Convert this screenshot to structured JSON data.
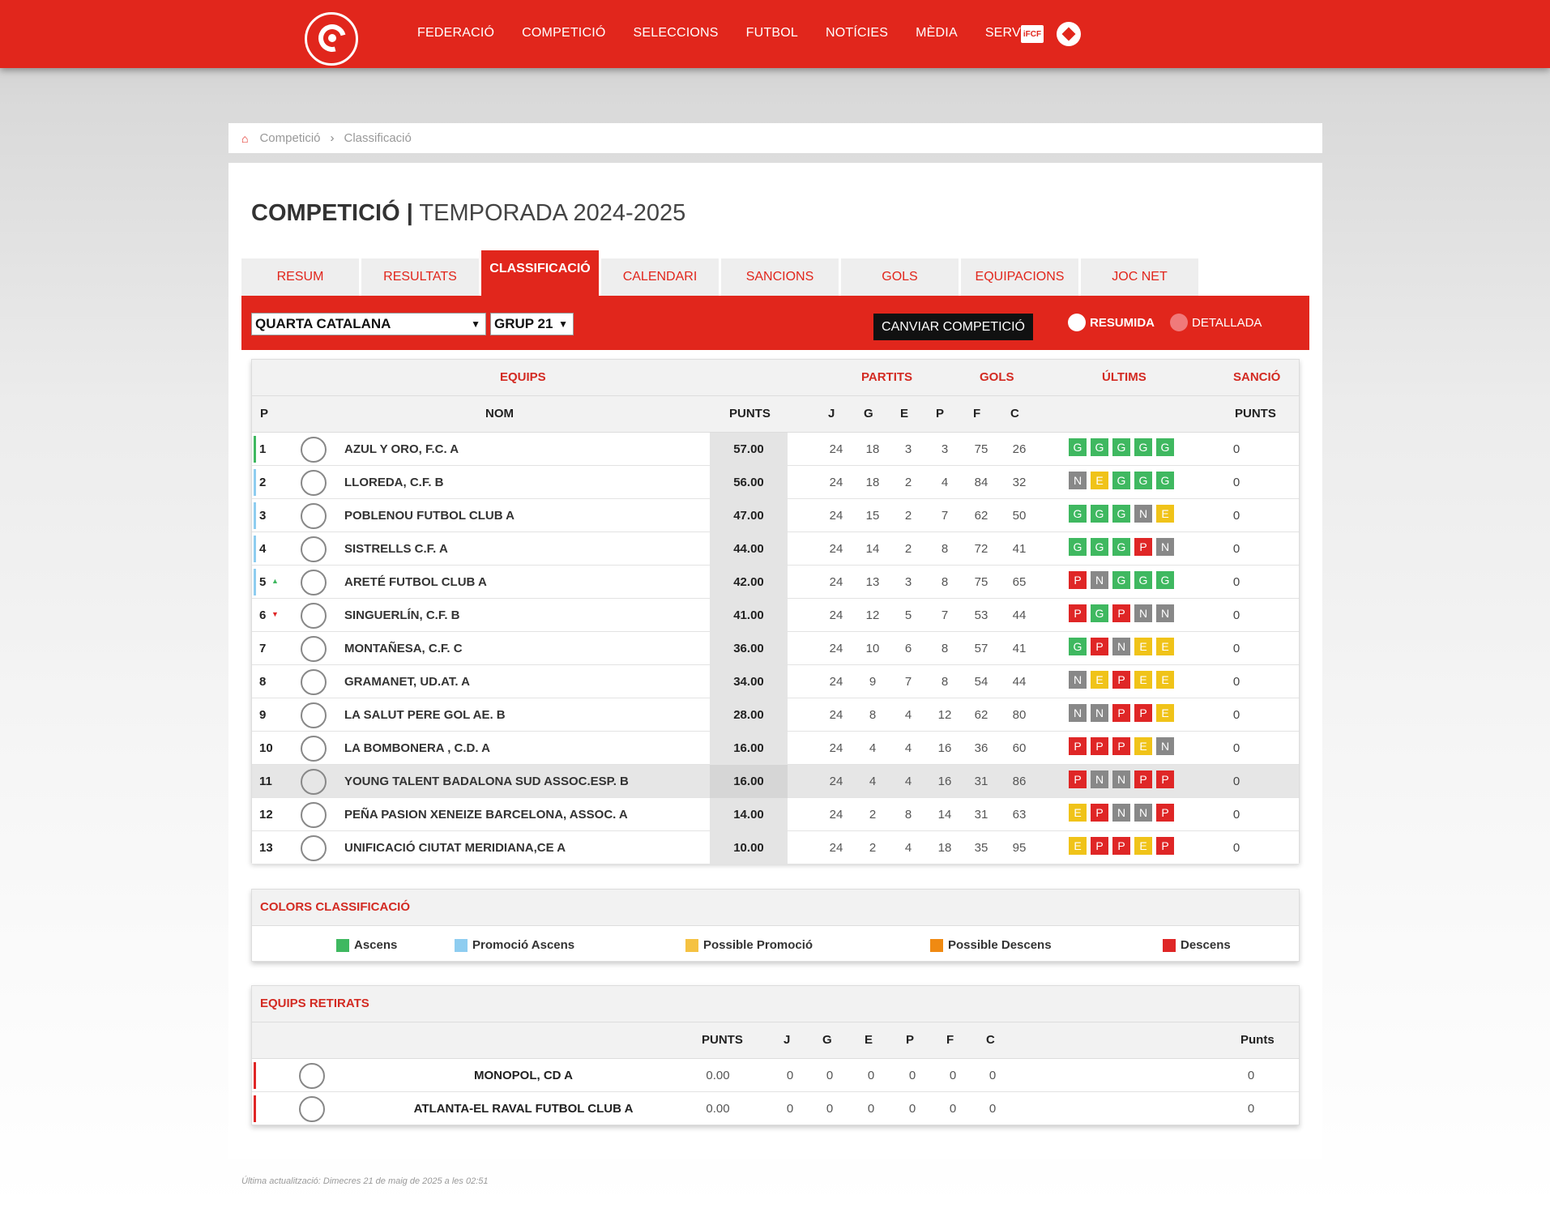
{
  "nav": {
    "items": [
      "FEDERACIÓ",
      "COMPETICIÓ",
      "SELECCIONS",
      "FUTBOL",
      "NOTÍCIES",
      "MÈDIA",
      "SERVEIS"
    ],
    "ifcf_label": "iFCF"
  },
  "breadcrumb": {
    "items": [
      "Competició",
      "Classificació"
    ]
  },
  "page": {
    "title_bold": "COMPETICIÓ |",
    "title_light": "TEMPORADA 2024-2025"
  },
  "tabs": [
    {
      "label": "RESUM"
    },
    {
      "label": "RESULTATS"
    },
    {
      "label": "CLASSIFICACIÓ",
      "active": true
    },
    {
      "label": "CALENDARI"
    },
    {
      "label": "SANCIONS"
    },
    {
      "label": "GOLS"
    },
    {
      "label": "EQUIPACIONS"
    },
    {
      "label": "JOC NET"
    }
  ],
  "filters": {
    "competition": "QUARTA CATALANA",
    "group": "GRUP 21",
    "change_button": "CANVIAR COMPETICIÓ",
    "radio_summary": "RESUMIDA",
    "radio_detailed": "DETALLADA"
  },
  "table": {
    "group_headers": {
      "equips": "EQUIPS",
      "partits": "PARTITS",
      "gols": "GOLS",
      "ultims": "ÚLTIMS",
      "sancio": "SANCIÓ"
    },
    "headers": {
      "p": "P",
      "nom": "NOM",
      "punts": "PUNTS",
      "j": "J",
      "g": "G",
      "e": "E",
      "pp": "P",
      "f": "F",
      "c": "C",
      "sanc_punts": "PUNTS"
    },
    "rows": [
      {
        "pos": "1",
        "trend": "",
        "name": "AZUL Y ORO, F.C. A",
        "pts": "57.00",
        "j": "24",
        "g": "18",
        "e": "3",
        "p": "3",
        "f": "75",
        "c": "26",
        "last": [
          "G",
          "G",
          "G",
          "G",
          "G"
        ],
        "sanc": "0",
        "marker": "#3fb860"
      },
      {
        "pos": "2",
        "trend": "",
        "name": "LLOREDA, C.F. B",
        "pts": "56.00",
        "j": "24",
        "g": "18",
        "e": "2",
        "p": "4",
        "f": "84",
        "c": "32",
        "last": [
          "N",
          "E",
          "G",
          "G",
          "G"
        ],
        "sanc": "0",
        "marker": "#8ecdf0"
      },
      {
        "pos": "3",
        "trend": "",
        "name": "POBLENOU FUTBOL CLUB A",
        "pts": "47.00",
        "j": "24",
        "g": "15",
        "e": "2",
        "p": "7",
        "f": "62",
        "c": "50",
        "last": [
          "G",
          "G",
          "G",
          "N",
          "E"
        ],
        "sanc": "0",
        "marker": "#8ecdf0"
      },
      {
        "pos": "4",
        "trend": "",
        "name": "SISTRELLS C.F. A",
        "pts": "44.00",
        "j": "24",
        "g": "14",
        "e": "2",
        "p": "8",
        "f": "72",
        "c": "41",
        "last": [
          "G",
          "G",
          "G",
          "P",
          "N"
        ],
        "sanc": "0",
        "marker": "#8ecdf0"
      },
      {
        "pos": "5",
        "trend": "up",
        "name": "ARETÉ FUTBOL CLUB A",
        "pts": "42.00",
        "j": "24",
        "g": "13",
        "e": "3",
        "p": "8",
        "f": "75",
        "c": "65",
        "last": [
          "P",
          "N",
          "G",
          "G",
          "G"
        ],
        "sanc": "0",
        "marker": "#8ecdf0"
      },
      {
        "pos": "6",
        "trend": "down",
        "name": "SINGUERLÍN, C.F. B",
        "pts": "41.00",
        "j": "24",
        "g": "12",
        "e": "5",
        "p": "7",
        "f": "53",
        "c": "44",
        "last": [
          "P",
          "G",
          "P",
          "N",
          "N"
        ],
        "sanc": "0",
        "marker": ""
      },
      {
        "pos": "7",
        "trend": "",
        "name": "MONTAÑESA, C.F. C",
        "pts": "36.00",
        "j": "24",
        "g": "10",
        "e": "6",
        "p": "8",
        "f": "57",
        "c": "41",
        "last": [
          "G",
          "P",
          "N",
          "E",
          "E"
        ],
        "sanc": "0",
        "marker": ""
      },
      {
        "pos": "8",
        "trend": "",
        "name": "GRAMANET, UD.AT. A",
        "pts": "34.00",
        "j": "24",
        "g": "9",
        "e": "7",
        "p": "8",
        "f": "54",
        "c": "44",
        "last": [
          "N",
          "E",
          "P",
          "E",
          "E"
        ],
        "sanc": "0",
        "marker": ""
      },
      {
        "pos": "9",
        "trend": "",
        "name": "LA SALUT PERE GOL AE. B",
        "pts": "28.00",
        "j": "24",
        "g": "8",
        "e": "4",
        "p": "12",
        "f": "62",
        "c": "80",
        "last": [
          "N",
          "N",
          "P",
          "P",
          "E"
        ],
        "sanc": "0",
        "marker": ""
      },
      {
        "pos": "10",
        "trend": "",
        "name": "LA BOMBONERA , C.D. A",
        "pts": "16.00",
        "j": "24",
        "g": "4",
        "e": "4",
        "p": "16",
        "f": "36",
        "c": "60",
        "last": [
          "P",
          "P",
          "P",
          "E",
          "N"
        ],
        "sanc": "0",
        "marker": ""
      },
      {
        "pos": "11",
        "trend": "",
        "name": "YOUNG TALENT BADALONA SUD ASSOC.ESP. B",
        "pts": "16.00",
        "j": "24",
        "g": "4",
        "e": "4",
        "p": "16",
        "f": "31",
        "c": "86",
        "last": [
          "P",
          "N",
          "N",
          "P",
          "P"
        ],
        "sanc": "0",
        "marker": "",
        "highlight": true
      },
      {
        "pos": "12",
        "trend": "",
        "name": "PEÑA PASION XENEIZE BARCELONA, ASSOC. A",
        "pts": "14.00",
        "j": "24",
        "g": "2",
        "e": "8",
        "p": "14",
        "f": "31",
        "c": "63",
        "last": [
          "E",
          "P",
          "N",
          "N",
          "P"
        ],
        "sanc": "0",
        "marker": ""
      },
      {
        "pos": "13",
        "trend": "",
        "name": "UNIFICACIÓ CIUTAT MERIDIANA,CE A",
        "pts": "10.00",
        "j": "24",
        "g": "2",
        "e": "4",
        "p": "18",
        "f": "35",
        "c": "95",
        "last": [
          "E",
          "P",
          "P",
          "E",
          "P"
        ],
        "sanc": "0",
        "marker": ""
      }
    ]
  },
  "colors": {
    "title": "COLORS CLASSIFICACIÓ",
    "items": [
      {
        "label": "Ascens",
        "color": "#3fb860"
      },
      {
        "label": "Promoció Ascens",
        "color": "#8ecdf0"
      },
      {
        "label": "Possible Promoció",
        "color": "#f5c242"
      },
      {
        "label": "Possible Descens",
        "color": "#f08a12"
      },
      {
        "label": "Descens",
        "color": "#df2626"
      }
    ]
  },
  "withdrawn": {
    "title": "EQUIPS RETIRATS",
    "headers": {
      "punts": "PUNTS",
      "j": "J",
      "g": "G",
      "e": "E",
      "p": "P",
      "f": "F",
      "c": "C",
      "sanc": "Punts"
    },
    "rows": [
      {
        "name": "MONOPOL, CD A",
        "pts": "0.00",
        "j": "0",
        "g": "0",
        "e": "0",
        "p": "0",
        "f": "0",
        "c": "0",
        "sanc": "0"
      },
      {
        "name": "ATLANTA-EL RAVAL FUTBOL CLUB A",
        "pts": "0.00",
        "j": "0",
        "g": "0",
        "e": "0",
        "p": "0",
        "f": "0",
        "c": "0",
        "sanc": "0"
      }
    ]
  },
  "footer": {
    "updated": "Última actualització: Dimecres 21 de maig de 2025 a les 02:51"
  }
}
